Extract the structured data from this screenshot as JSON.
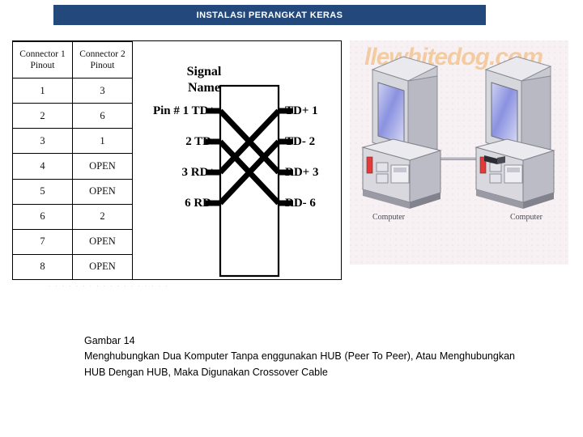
{
  "banner": {
    "title": "INSTALASI PERANGKAT KERAS",
    "background_color": "#23497c",
    "text_color": "#ffffff"
  },
  "pinout_table": {
    "headers": [
      "Connector 1 Pinout",
      "Connector 2 Pinout"
    ],
    "header_left_line1": "Connector 1",
    "header_left_line2": "Pinout",
    "header_right_line1": "Connector 2",
    "header_right_line2": "Pinout",
    "rows": [
      {
        "connector1": "1",
        "connector2": "3"
      },
      {
        "connector1": "2",
        "connector2": "6"
      },
      {
        "connector1": "3",
        "connector2": "1"
      },
      {
        "connector1": "4",
        "connector2": "OPEN"
      },
      {
        "connector1": "5",
        "connector2": "OPEN"
      },
      {
        "connector1": "6",
        "connector2": "2"
      },
      {
        "connector1": "7",
        "connector2": "OPEN"
      },
      {
        "connector1": "8",
        "connector2": "OPEN"
      }
    ]
  },
  "crossover_diagram": {
    "heading_line1": "Signal",
    "heading_line2": "Name",
    "left_pins": [
      "Pin # 1 TD+",
      "2 TD-",
      "3 RD+",
      "6 RD-"
    ],
    "right_pins": [
      "TD+ 1",
      "TD- 2",
      "RD+ 3",
      "RD- 6"
    ],
    "crossings": [
      {
        "from": "1 TD+",
        "to": "RD+ 3"
      },
      {
        "from": "2 TD-",
        "to": "RD- 6"
      },
      {
        "from": "3 RD+",
        "to": "TD+ 1"
      },
      {
        "from": "6 RD-",
        "to": "TD- 2"
      }
    ]
  },
  "faint_strip": {
    "text": ". .   . .  . .    . .  . .    . .   . . .  . . ."
  },
  "computers_photo": {
    "watermark": "llewhitedog.com",
    "watermark_color": "#eb9628",
    "left_label": "Computer",
    "right_label": "Computer",
    "background_color": "#f8f1f4"
  },
  "caption": {
    "figure_label": "Gambar 14",
    "body": "Menghubungkan Dua Komputer Tanpa  enggunakan HUB (Peer To Peer), Atau Menghubungkan HUB Dengan HUB, Maka Digunakan Crossover Cable"
  }
}
